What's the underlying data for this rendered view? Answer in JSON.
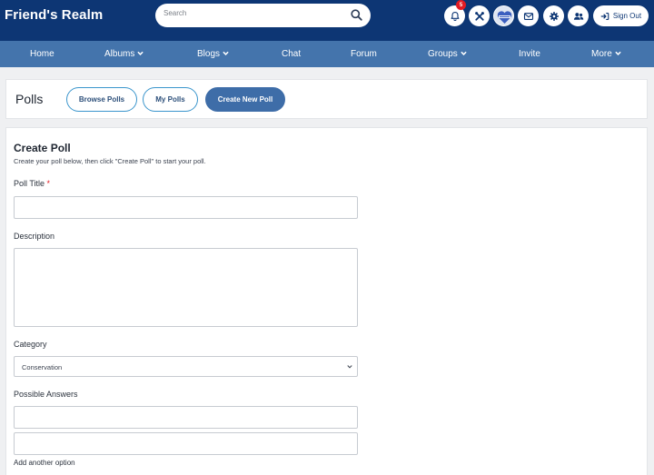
{
  "header": {
    "logo": "Friend's Realm",
    "search": {
      "placeholder": "Search"
    },
    "notification_count": "5",
    "icons": [
      "bell-icon",
      "tools-icon",
      "avatar",
      "envelope-icon",
      "gear-icon",
      "users-icon"
    ],
    "signout_label": "Sign Out"
  },
  "nav": {
    "items": [
      {
        "label": "Home",
        "dropdown": false
      },
      {
        "label": "Albums",
        "dropdown": true
      },
      {
        "label": "Blogs",
        "dropdown": true
      },
      {
        "label": "Chat",
        "dropdown": false
      },
      {
        "label": "Forum",
        "dropdown": false
      },
      {
        "label": "Groups",
        "dropdown": true
      },
      {
        "label": "Invite",
        "dropdown": false
      },
      {
        "label": "More",
        "dropdown": true
      }
    ]
  },
  "polls": {
    "title": "Polls",
    "tabs": [
      {
        "label": "Browse Polls",
        "active": false
      },
      {
        "label": "My Polls",
        "active": false
      },
      {
        "label": "Create New Poll",
        "active": true
      }
    ]
  },
  "form": {
    "title": "Create Poll",
    "subtitle": "Create your poll below, then click \"Create Poll\" to start your poll.",
    "poll_title_label": "Poll Title",
    "required_mark": "*",
    "poll_title_value": "",
    "description_label": "Description",
    "description_value": "",
    "category_label": "Category",
    "category_value": "Conservation",
    "answers_label": "Possible Answers",
    "answers": [
      "",
      ""
    ],
    "add_option": "Add another option"
  },
  "colors": {
    "header_bg": "#0d3674",
    "nav_bg": "#4474ac",
    "accent": "#3e6da8",
    "pill_border": "#3a95cc",
    "badge": "#e21b23",
    "page_bg": "#eff0f2"
  }
}
